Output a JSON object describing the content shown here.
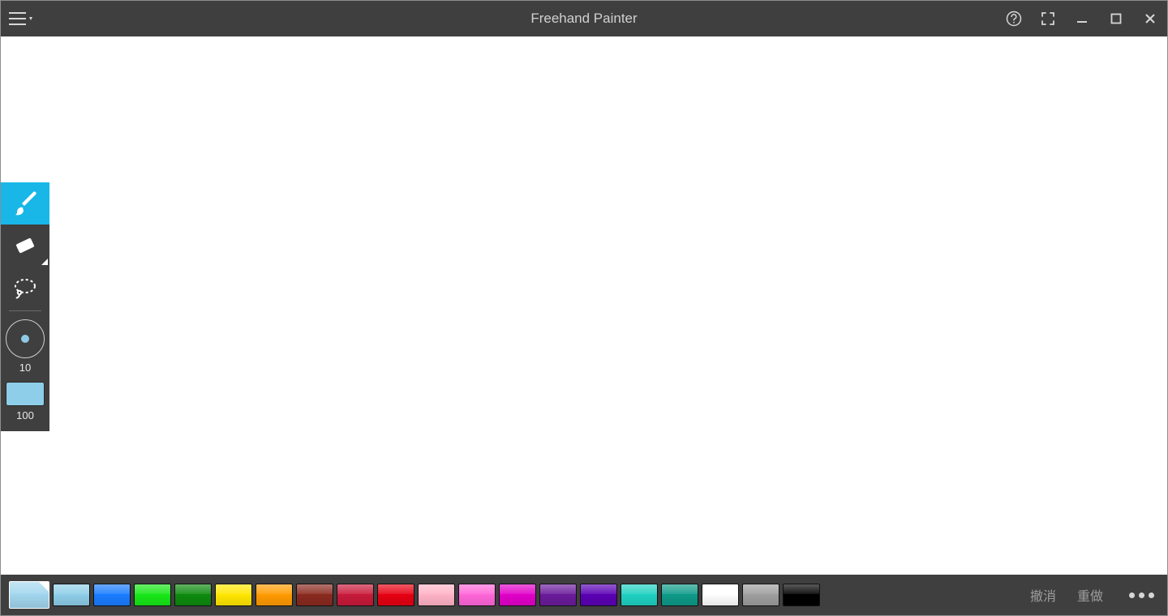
{
  "app": {
    "title": "Freehand Painter"
  },
  "toolbox": {
    "tools": [
      {
        "name": "brush",
        "active": true
      },
      {
        "name": "eraser",
        "active": false
      },
      {
        "name": "lasso",
        "active": false
      }
    ],
    "size_value": "10",
    "opacity_value": "100",
    "opacity_swatch_color": "#8ecee8"
  },
  "palette": {
    "selected_index": 0,
    "colors": [
      "#a2d6ee",
      "#8ecee8",
      "#1a7cff",
      "#17e617",
      "#0e8a0e",
      "#ffe600",
      "#ff9a00",
      "#8a2a1f",
      "#c81a3a",
      "#e60012",
      "#ffb3c6",
      "#ff66d9",
      "#e000c8",
      "#6a1b9a",
      "#5a00b3",
      "#1fd1c1",
      "#0e9a88",
      "#ffffff",
      "#9e9e9e",
      "#000000"
    ]
  },
  "bottombar": {
    "undo_label": "撤消",
    "redo_label": "重做"
  }
}
